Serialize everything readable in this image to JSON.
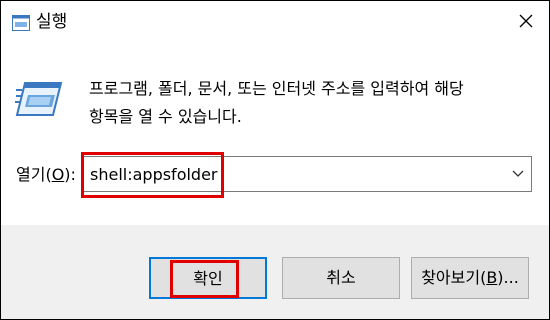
{
  "window": {
    "title": "실행",
    "icon": "run-app-icon",
    "close_icon": "close-icon"
  },
  "description": {
    "line1": "프로그램, 폴더, 문서, 또는 인터넷 주소를 입력하여 해당",
    "line2": "항목을 열 수 있습니다."
  },
  "open": {
    "label_prefix": "열기(",
    "label_hotkey": "O",
    "label_suffix": "):",
    "value": "shell:appsfolder"
  },
  "buttons": {
    "ok": "확인",
    "cancel": "취소",
    "browse_prefix": "찾아보기(",
    "browse_hotkey": "B",
    "browse_suffix": ")..."
  },
  "colors": {
    "highlight": "#e00000",
    "focus_border": "#0078d7",
    "footer_bg": "#f0f0f0"
  }
}
